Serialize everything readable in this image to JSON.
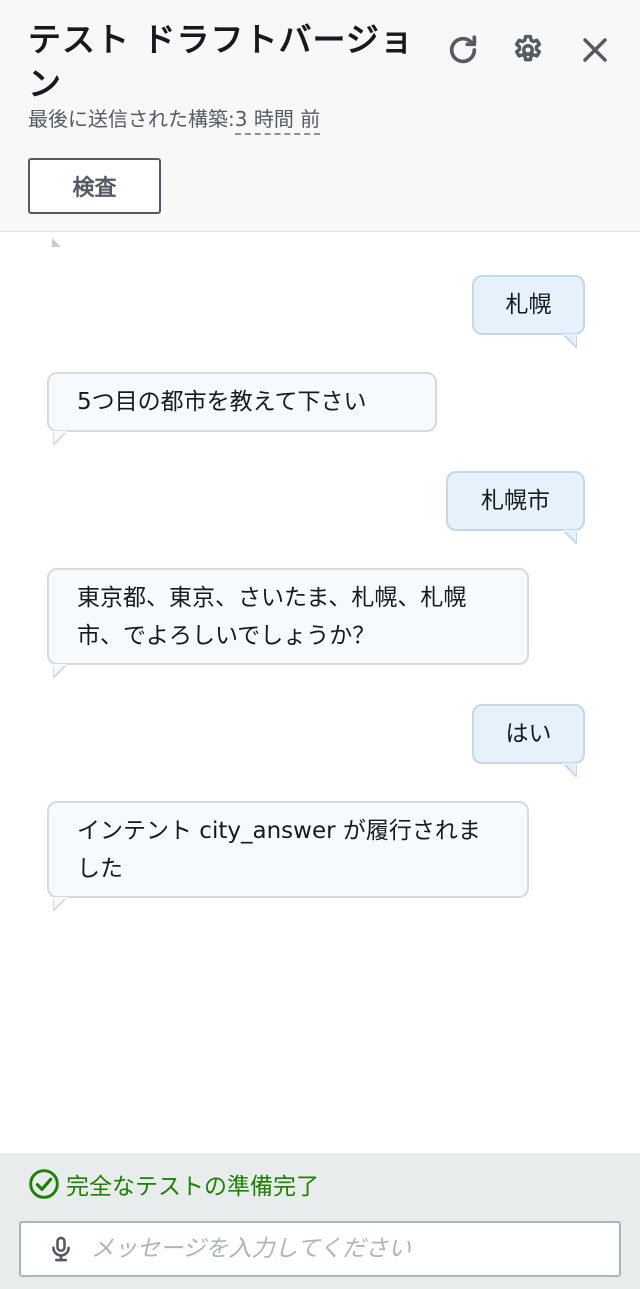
{
  "header": {
    "title": "テスト ドラフトバージョン",
    "last_built_label": "最後に送信された構築:",
    "last_built_time": "3 時間 前",
    "inspect_label": "検査",
    "icons": [
      "refresh-icon",
      "gear-icon",
      "close-icon"
    ]
  },
  "messages": [
    {
      "role": "user",
      "text": "札幌"
    },
    {
      "role": "bot",
      "text": "5つ目の都市を教えて下さい"
    },
    {
      "role": "user",
      "text": "札幌市"
    },
    {
      "role": "bot",
      "text": "東京都、東京、さいたま、札幌、札幌市、でよろしいでしょうか？"
    },
    {
      "role": "user",
      "text": "はい"
    },
    {
      "role": "bot",
      "text": "インテント city_answer が履行されました"
    }
  ],
  "footer": {
    "status": "完全なテストの準備完了",
    "input_placeholder": "メッセージを入力してください",
    "input_value": ""
  },
  "colors": {
    "header_bg": "#f8f8f8",
    "user_bubble": "#e6f2fb",
    "bot_bubble": "#f7fafd",
    "ready_green": "#1d8102",
    "footer_bg": "#e9ecec"
  }
}
